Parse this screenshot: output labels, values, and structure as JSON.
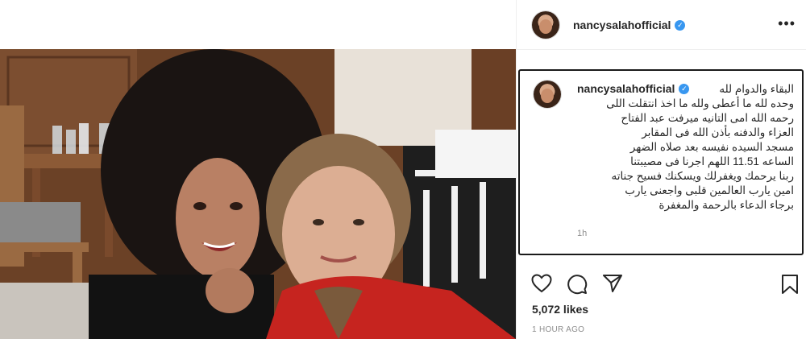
{
  "post": {
    "username": "nancysalahofficial",
    "verified_badge": "✓",
    "more_icon": "•••",
    "caption_username": "nancysalahofficial",
    "caption_lines": [
      "البقاء والدوام لله",
      "وحده لله ما أعطى ولله ما اخذ انتقلت اللى",
      "رحمه الله امى التانيه ميرفت عبد الفتاح",
      "العزاء والدفنه بأذن الله فى المقابر",
      "مسجد السيده نفيسه بعد صلاه الضهر",
      "الساعه 11.51 اللهم اجرنا فى مصيبتنا",
      "ربنا يرحمك ويغفرلك ويسكنك فسيح جناته",
      "امين يارب العالمين قلبى واجعنى يارب",
      "برجاء الدعاء بالرحمة والمغفرة"
    ],
    "caption_time": "1h",
    "likes": "5,072 likes",
    "time_ago": "1 HOUR AGO"
  },
  "icons": {
    "like": "heart-icon",
    "comment": "comment-icon",
    "share": "share-icon",
    "save": "bookmark-icon"
  },
  "colors": {
    "verified": "#3897f0",
    "text": "#262626",
    "muted": "#8e8e8e",
    "border": "#efefef"
  }
}
